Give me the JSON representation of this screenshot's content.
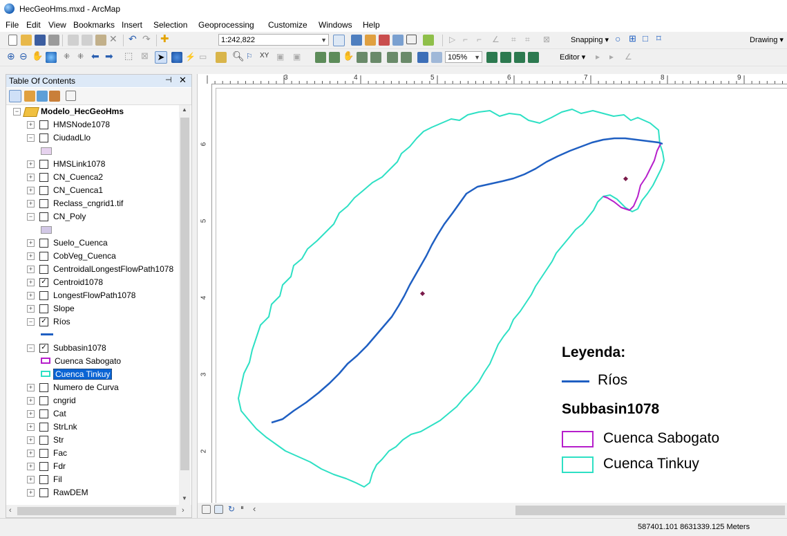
{
  "window": {
    "title": "HecGeoHms.mxd - ArcMap"
  },
  "menu": [
    "File",
    "Edit",
    "View",
    "Bookmarks",
    "Insert",
    "Selection",
    "Geoprocessing",
    "Customize",
    "Windows",
    "Help"
  ],
  "toolbar1": {
    "scale": "1:242,822",
    "snapping": "Snapping",
    "drawing": "Drawing"
  },
  "toolbar2": {
    "zoom": "105%",
    "editor": "Editor"
  },
  "toc": {
    "title": "Table Of Contents",
    "group": "Modelo_HecGeoHms",
    "layers": [
      {
        "name": "HMSNode1078",
        "checked": false
      },
      {
        "name": "CiudadLlo",
        "checked": false
      },
      {
        "name": "HMSLink1078",
        "checked": false
      },
      {
        "name": "CN_Cuenca2",
        "checked": false
      },
      {
        "name": "CN_Cuenca1",
        "checked": false
      },
      {
        "name": "Reclass_cngrid1.tif",
        "checked": false
      },
      {
        "name": "CN_Poly",
        "checked": false
      },
      {
        "name": "Suelo_Cuenca",
        "checked": false
      },
      {
        "name": "CobVeg_Cuenca",
        "checked": false
      },
      {
        "name": "CentroidalLongestFlowPath1078",
        "checked": false
      },
      {
        "name": "Centroid1078",
        "checked": true
      },
      {
        "name": "LongestFlowPath1078",
        "checked": false
      },
      {
        "name": "Slope",
        "checked": false
      },
      {
        "name": "Ríos",
        "checked": true
      },
      {
        "name": "Subbasin1078",
        "checked": true
      },
      {
        "name": "Numero de Curva",
        "checked": false
      },
      {
        "name": "cngrid",
        "checked": false
      },
      {
        "name": "Cat",
        "checked": false
      },
      {
        "name": "StrLnk",
        "checked": false
      },
      {
        "name": "Str",
        "checked": false
      },
      {
        "name": "Fac",
        "checked": false
      },
      {
        "name": "Fdr",
        "checked": false
      },
      {
        "name": "Fil",
        "checked": false
      },
      {
        "name": "RawDEM",
        "checked": false
      }
    ],
    "subbasin_classes": [
      "Cuenca Sabogato",
      "Cuenca Tinkuy"
    ]
  },
  "rulers": {
    "h": [
      "3",
      "4",
      "5",
      "6",
      "7",
      "8",
      "9"
    ],
    "v": [
      "6",
      "5",
      "4",
      "3",
      "2"
    ]
  },
  "legend": {
    "title": "Leyenda:",
    "rios": "Ríos",
    "subbasin": "Subbasin1078",
    "sabogato": "Cuenca Sabogato",
    "tinkuy": "Cuenca Tinkuy"
  },
  "colors": {
    "rios": "#1f5fc2",
    "sabogato": "#b61ecb",
    "tinkuy": "#2de0c4",
    "centroid": "#7a1a4a"
  },
  "status": {
    "coords": "587401.101  8631339.125 Meters"
  }
}
